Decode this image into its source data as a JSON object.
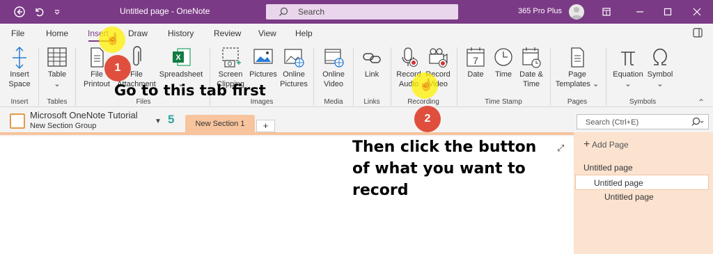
{
  "titlebar": {
    "title": "Untitled page  -  OneNote",
    "search_label": "Search",
    "user_name": "365 Pro Plus"
  },
  "menu": {
    "items": [
      "File",
      "Home",
      "Insert",
      "Draw",
      "History",
      "Review",
      "View",
      "Help"
    ],
    "active": "Insert"
  },
  "ribbon": {
    "insert_space": [
      "Insert",
      "Space"
    ],
    "table": [
      "Table"
    ],
    "file_printout": [
      "File",
      "Printout"
    ],
    "file_attachment": [
      "File",
      "Attachment"
    ],
    "spreadsheet": [
      "Spreadsheet"
    ],
    "screen_clipping": [
      "Screen",
      "Clipping"
    ],
    "pictures": [
      "Pictures"
    ],
    "online_pictures": [
      "Online",
      "Pictures"
    ],
    "online_video": [
      "Online",
      "Video"
    ],
    "link": [
      "Link"
    ],
    "record_audio": [
      "Record",
      "Audio"
    ],
    "record_video": [
      "Record",
      "Video"
    ],
    "date": [
      "Date"
    ],
    "time": [
      "Time"
    ],
    "date_time": [
      "Date &",
      "Time"
    ],
    "page_templates": [
      "Page",
      "Templates"
    ],
    "equation": [
      "Equation"
    ],
    "symbol": [
      "Symbol"
    ],
    "groups": {
      "insert": "Insert",
      "tables": "Tables",
      "files": "Files",
      "images": "Images",
      "media": "Media",
      "links": "Links",
      "recording": "Recording",
      "time_stamp": "Time Stamp",
      "pages": "Pages",
      "symbols": "Symbols"
    }
  },
  "notebook": {
    "title": "Microsoft OneNote Tutorial",
    "section_group": "New Section Group",
    "section_tab": "New Section 1",
    "add_tab": "+",
    "page_search_placeholder": "Search (Ctrl+E)"
  },
  "pages": {
    "add_page": "Add Page",
    "list": [
      "Untitled page",
      "Untitled page",
      "Untitled page"
    ]
  },
  "annotations": {
    "step1_number": "1",
    "step1_text": "Go to this tab first",
    "step2_number": "2",
    "step2_text_lines": [
      "Then click the button",
      "of what you want to",
      "record"
    ]
  },
  "colors": {
    "brand": "#7b3a86",
    "section_tab": "#f7c49d",
    "page_pane": "#fce3d0",
    "badge": "#e04f3d"
  }
}
